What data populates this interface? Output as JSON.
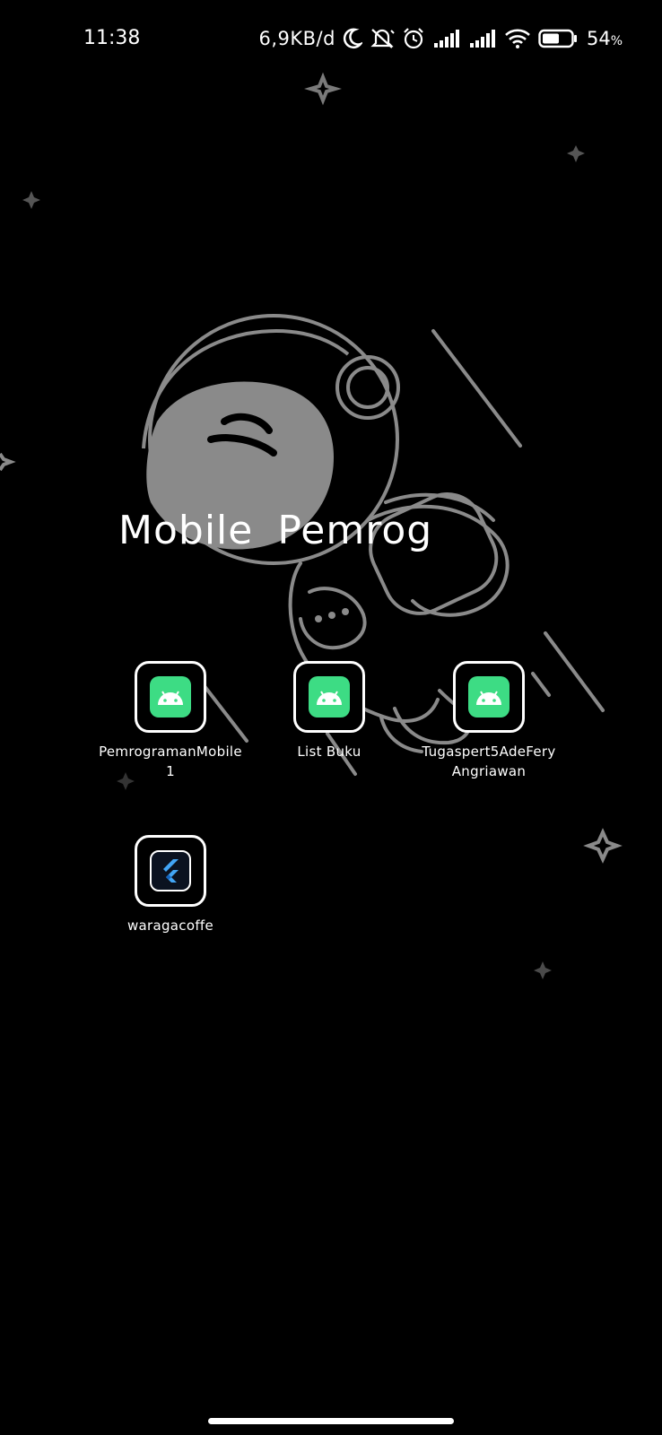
{
  "status_bar": {
    "time": "11:38",
    "net_speed": "6,9KB/d",
    "battery_value": "54",
    "battery_unit": "%",
    "icons": [
      "moon-icon",
      "bell-off-icon",
      "alarm-icon",
      "signal-icon",
      "signal-icon",
      "wifi-icon",
      "battery-icon"
    ]
  },
  "folder": {
    "title": "Mobile Pemrog"
  },
  "apps": [
    {
      "label_line1": "PemrogramanMobile",
      "label_line2": "1",
      "icon": "android-icon"
    },
    {
      "label_line1": "List Buku",
      "label_line2": "",
      "icon": "android-icon"
    },
    {
      "label_line1": "Tugaspert5AdeFery",
      "label_line2": "Angriawan",
      "icon": "android-icon"
    },
    {
      "label_line1": "waragacoffe",
      "label_line2": "",
      "icon": "flutter-icon"
    }
  ],
  "colors": {
    "android_tile": "#3ddc84",
    "flutter_blue": "#42a5f5",
    "wallpaper_line": "#8a8a8a"
  }
}
